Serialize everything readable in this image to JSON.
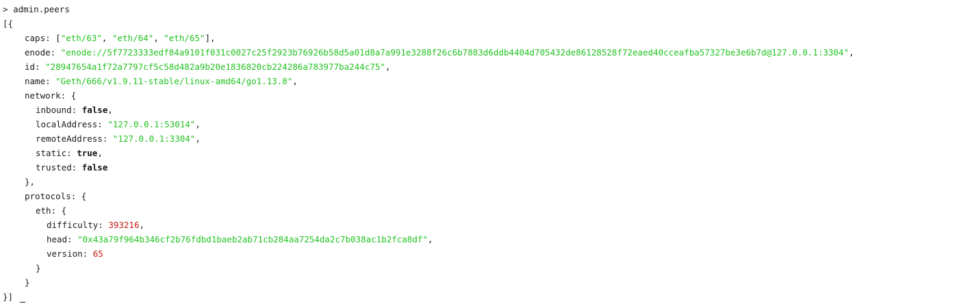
{
  "terminal": {
    "prompt": "> ",
    "command": "admin.peers",
    "open": "[{",
    "close": "}]"
  },
  "peer": {
    "caps": [
      "\"eth/63\"",
      "\"eth/64\"",
      "\"eth/65\""
    ],
    "enode": "\"enode://5f7723333edf84a9101f031c0027c25f2923b76926b58d5a01d8a7a991e3288f26c6b7883d6ddb4404d705432de86128528f72eaed40cceafba57327be3e6b7d@127.0.0.1:3304\"",
    "id": "\"28947654a1f72a7797cf5c58d482a9b20e1836820cb224286a783977ba244c75\"",
    "name": "\"Geth/666/v1.9.11-stable/linux-amd64/go1.13.8\"",
    "network": {
      "inbound": "false",
      "localAddress": "\"127.0.0.1:53014\"",
      "remoteAddress": "\"127.0.0.1:3304\"",
      "static": "true",
      "trusted": "false"
    },
    "protocols": {
      "eth": {
        "difficulty": "393216",
        "head": "\"0x43a79f964b346cf2b76fdbd1baeb2ab71cb284aa7254da2c7b038ac1b2fca8df\"",
        "version": "65"
      }
    }
  },
  "colors": {
    "string": "#22c322",
    "number": "#c41a16",
    "text": "#1a1a1a"
  }
}
